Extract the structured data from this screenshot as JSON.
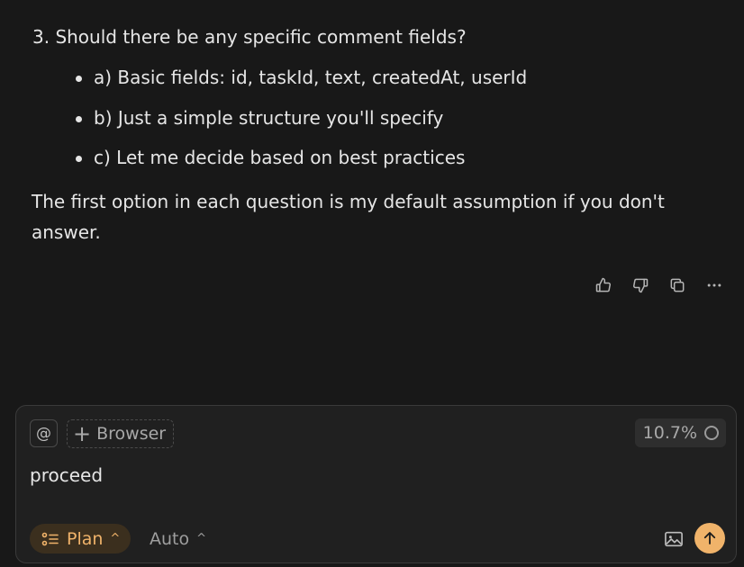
{
  "message": {
    "question": "3. Should there be any specific comment fields?",
    "options": [
      "a) Basic fields: id, taskId, text, createdAt, userId",
      "b) Just a simple structure you'll specify",
      "c) Let me decide based on best practices"
    ],
    "footnote": "The first option in each question is my default assumption if you don't answer."
  },
  "actions": {
    "icons": [
      "thumbs-up-icon",
      "thumbs-down-icon",
      "copy-icon",
      "more-icon"
    ]
  },
  "composer": {
    "at_symbol": "@",
    "browser_label": "Browser",
    "context_usage": "10.7%",
    "input_value": "proceed",
    "mode_label": "Plan",
    "model_label": "Auto",
    "colors": {
      "accent": "#f0b36a",
      "mode_bg": "#3b2f1e",
      "background": "#181818",
      "panel": "#202020"
    }
  }
}
